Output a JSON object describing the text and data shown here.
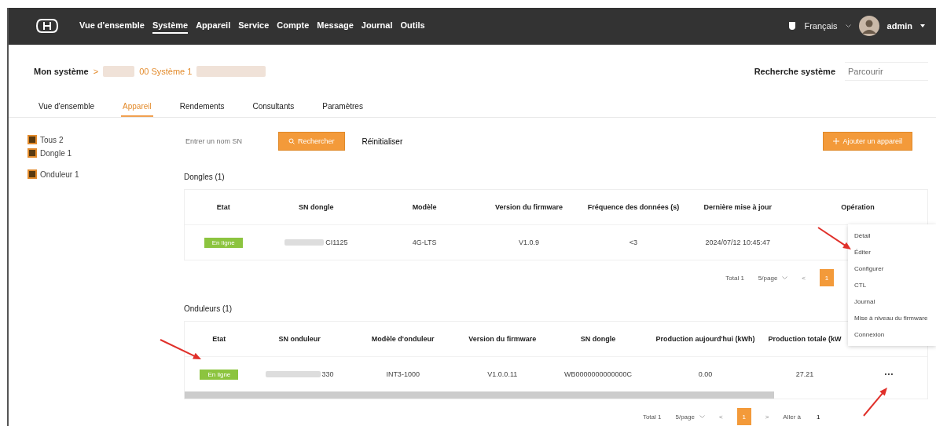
{
  "topbar": {
    "nav": [
      {
        "label": "Vue d'ensemble",
        "selected": false
      },
      {
        "label": "Système",
        "selected": true
      },
      {
        "label": "Appareil",
        "selected": false
      },
      {
        "label": "Service",
        "selected": false
      },
      {
        "label": "Compte",
        "selected": false
      },
      {
        "label": "Message",
        "selected": false
      },
      {
        "label": "Journal",
        "selected": false
      },
      {
        "label": "Outils",
        "selected": false
      }
    ],
    "language": "Français",
    "user": "admin"
  },
  "breadcrumb": {
    "root": "Mon système",
    "separator": ">",
    "current": "00 Système 1"
  },
  "system_search": {
    "label": "Recherche système",
    "placeholder": "Parcourir"
  },
  "tabs": [
    {
      "label": "Vue d'ensemble",
      "selected": false
    },
    {
      "label": "Appareil",
      "selected": true
    },
    {
      "label": "Rendements",
      "selected": false
    },
    {
      "label": "Consultants",
      "selected": false
    },
    {
      "label": "Paramètres",
      "selected": false
    }
  ],
  "tree": [
    {
      "label": "Tous 2",
      "checked": true
    },
    {
      "label": "Dongle 1",
      "checked": true
    },
    {
      "label": "Onduleur 1",
      "checked": true
    }
  ],
  "toolbar": {
    "search_placeholder": "Entrer un nom SN",
    "search_button": "Rechercher",
    "reset_button": "Réinitialiser",
    "add_button": "Ajouter un appareil"
  },
  "sections": [
    {
      "title": "Dongles (1)",
      "columns": [
        "Etat",
        "SN dongle",
        "Modèle",
        "Version du firmware",
        "Fréquence des données (s)",
        "Dernière mise à jour",
        "Opération"
      ],
      "rows": [
        {
          "color": "#8cc43f",
          "cells": [
            "En ligne",
            "CI1125",
            "4G-LTS",
            "V1.0.9",
            "<3",
            "2024/07/12 10:45:47",
            ""
          ]
        }
      ],
      "pagination": {
        "total": "Total 1",
        "per_page": "5/page",
        "prev": "<",
        "pages": [
          {
            "label": "1",
            "selected": true
          }
        ]
      }
    },
    {
      "title": "Onduleurs (1)",
      "columns": [
        "Etat",
        "SN onduleur",
        "Modèle d'onduleur",
        "Version du firmware",
        "SN dongle",
        "Production aujourd'hui (kWh)",
        "Production totale (kW",
        ""
      ],
      "rows": [
        {
          "color": "#8cc43f",
          "cells": [
            "En ligne",
            "330",
            "INT3-1000",
            "V1.0.0.11",
            "WB0000000000000C",
            "0.00",
            "27.21",
            "···"
          ]
        }
      ],
      "scrollbar": true,
      "pagination": {
        "total": "Total 1",
        "per_page": "5/page",
        "prev": "<",
        "pages": [
          {
            "label": "1",
            "selected": true
          }
        ],
        "next": ">",
        "goto": "Aller à",
        "goto_value": "1"
      }
    }
  ],
  "operation_menu": [
    "Détail",
    "Éditer",
    "Configurer",
    "CTL",
    "Journal",
    "Mise à niveau du firmware",
    "Connexion"
  ]
}
